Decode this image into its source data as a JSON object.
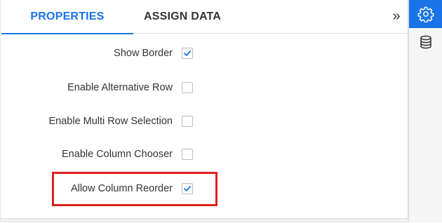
{
  "tabs": [
    {
      "label": "PROPERTIES",
      "active": true
    },
    {
      "label": "ASSIGN DATA",
      "active": false
    }
  ],
  "collapse_icon": "chevrons-right-icon",
  "properties": [
    {
      "label": "Show Border",
      "checked": true
    },
    {
      "label": "Enable Alternative Row",
      "checked": false
    },
    {
      "label": "Enable Multi Row Selection",
      "checked": false
    },
    {
      "label": "Enable Column Chooser",
      "checked": false
    },
    {
      "label": "Allow Column Reorder",
      "checked": true
    }
  ],
  "rail": [
    {
      "icon": "gear-icon",
      "active": true
    },
    {
      "icon": "database-icon",
      "active": false
    }
  ],
  "colors": {
    "accent": "#1a73e8",
    "highlight": "#e01e1e",
    "check": "#1a73e8"
  }
}
